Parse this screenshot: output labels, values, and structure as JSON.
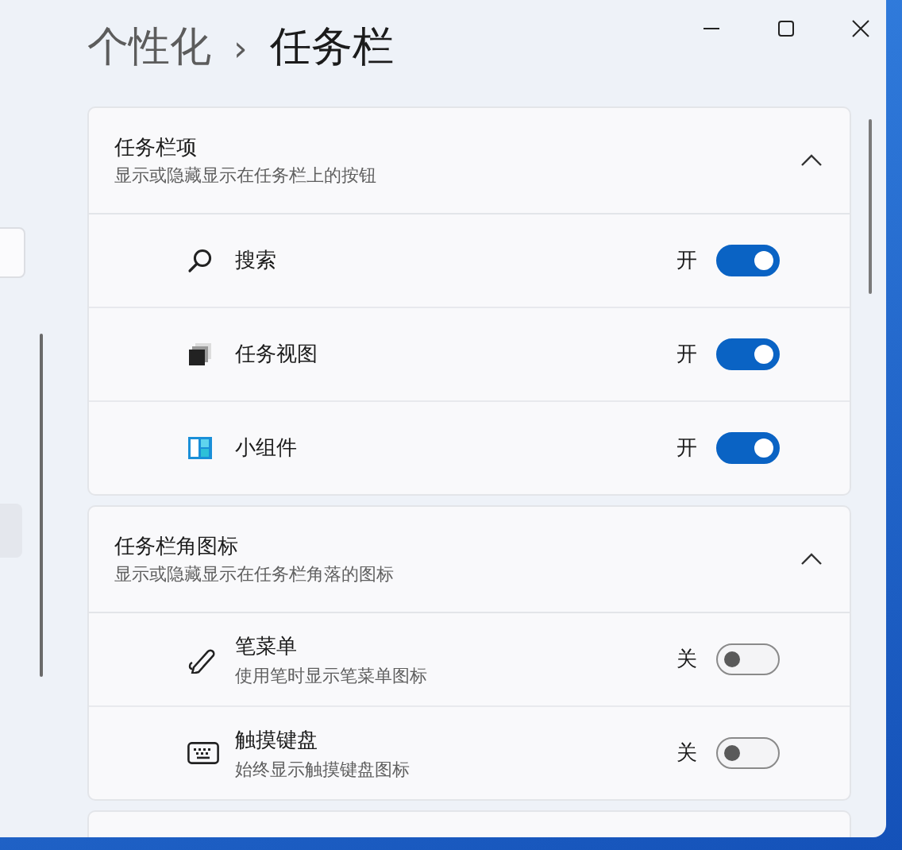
{
  "breadcrumb": {
    "parent": "个性化",
    "separator": "›",
    "current": "任务栏"
  },
  "sections": [
    {
      "title": "任务栏项",
      "subtitle": "显示或隐藏显示在任务栏上的按钮",
      "expanded": true,
      "items": [
        {
          "kind": "search",
          "label": "搜索",
          "state_label": "开",
          "on": true
        },
        {
          "kind": "task-view",
          "label": "任务视图",
          "state_label": "开",
          "on": true
        },
        {
          "kind": "widgets",
          "label": "小组件",
          "state_label": "开",
          "on": true
        }
      ]
    },
    {
      "title": "任务栏角图标",
      "subtitle": "显示或隐藏显示在任务栏角落的图标",
      "expanded": true,
      "items": [
        {
          "kind": "pen",
          "label": "笔菜单",
          "description": "使用笔时显示笔菜单图标",
          "state_label": "关",
          "on": false
        },
        {
          "kind": "keyboard",
          "label": "触摸键盘",
          "description": "始终显示触摸键盘图标",
          "state_label": "关",
          "on": false
        }
      ]
    }
  ]
}
